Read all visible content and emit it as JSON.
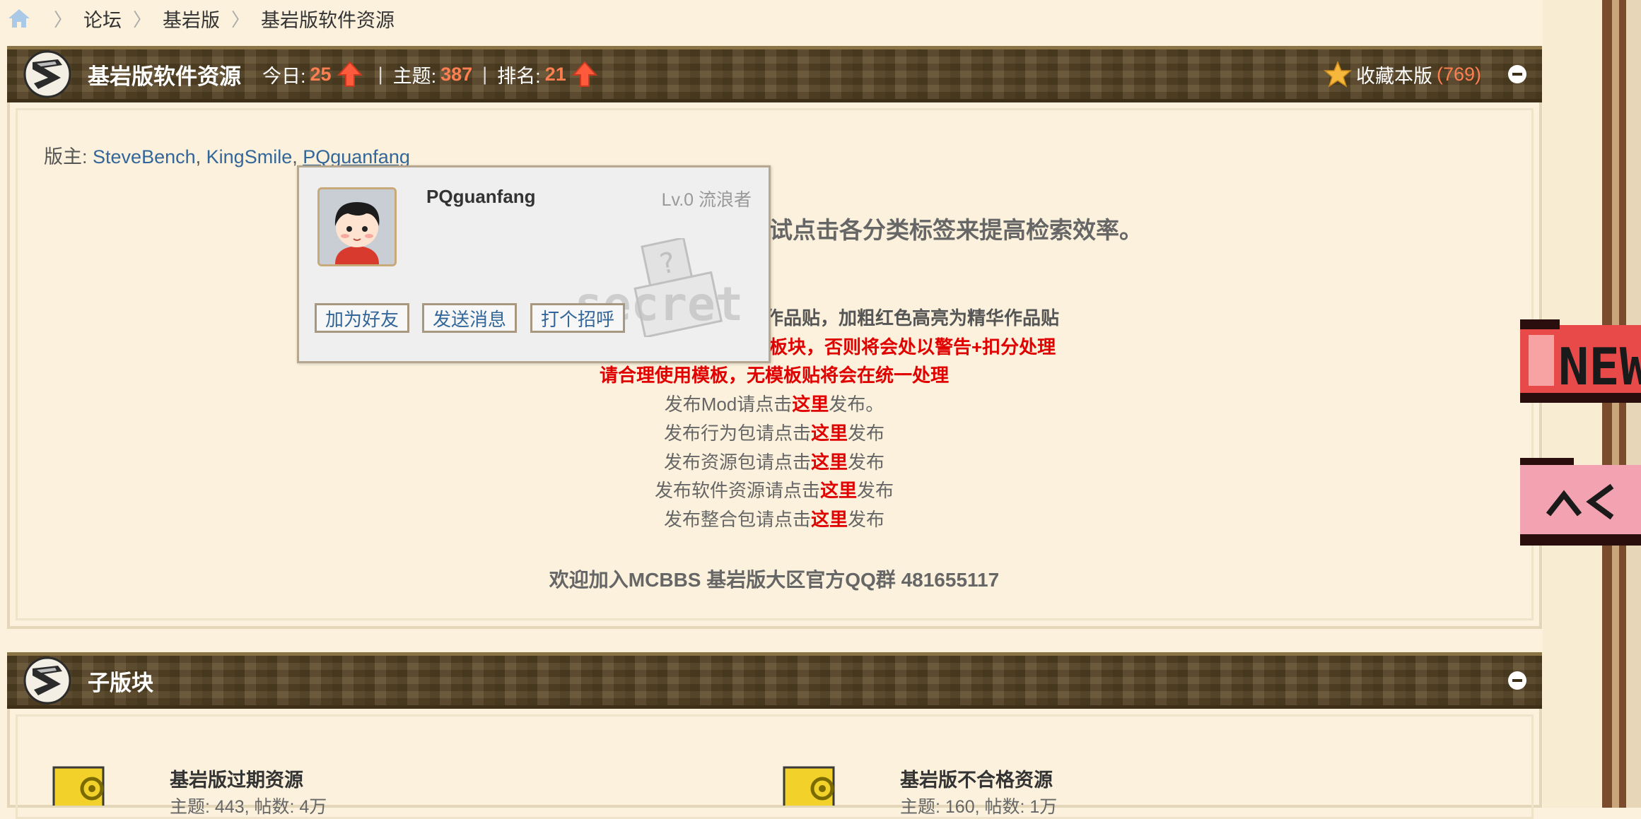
{
  "breadcrumb": {
    "items": [
      "论坛",
      "基岩版",
      "基岩版软件资源"
    ],
    "separator": "〉"
  },
  "forum_header": {
    "title": "基岩版软件资源",
    "today_label": "今日:",
    "today_value": "25",
    "topics_label": "主题:",
    "topics_value": "387",
    "rank_label": "排名:",
    "rank_value": "21",
    "favorite_label": "收藏本版",
    "favorite_count": "(769)"
  },
  "moderators": {
    "label": "版主:",
    "names": [
      "SteveBench",
      "KingSmile",
      "PQguanfang"
    ]
  },
  "popup": {
    "username": "PQguanfang",
    "level": "Lv.0 流浪者",
    "buttons": [
      "加为好友",
      "发送消息",
      "打个招呼"
    ]
  },
  "rules": {
    "line1_visible": "试点击各分类标签来提高检索效率。",
    "line2_visible": "作品贴，加粗红色高亮为精华作品贴",
    "line3_visible": "板块，否则将会处以警告+扣分处理",
    "line4": "请合理使用模板，无模板贴将会在统一处理",
    "post_mod": {
      "prefix": "发布Mod请点击",
      "link": "这里",
      "suffix": "发布。"
    },
    "post_behavior": {
      "prefix": "发布行为包请点击",
      "link": "这里",
      "suffix": "发布"
    },
    "post_resource": {
      "prefix": "发布资源包请点击",
      "link": "这里",
      "suffix": "发布"
    },
    "post_software": {
      "prefix": "发布软件资源请点击",
      "link": "这里",
      "suffix": "发布"
    },
    "post_pack": {
      "prefix": "发布整合包请点击",
      "link": "这里",
      "suffix": "发布"
    },
    "qq_group": "欢迎加入MCBBS 基岩版大区官方QQ群 481655117"
  },
  "subforum_header": {
    "title": "子版块"
  },
  "subforums": [
    {
      "name": "基岩版过期资源",
      "meta": "主题: 443, 帖数: 4万"
    },
    {
      "name": "基岩版不合格资源",
      "meta": "主题: 160, 帖数: 1万"
    }
  ],
  "colors": {
    "bar_brown": "#5e4a2a",
    "accent_orange": "#ff7f50",
    "link_blue": "#336699",
    "highlight_red": "#e00000",
    "page_bg": "#fbf1dc"
  },
  "icons": [
    "home-icon",
    "forum-logo-icon",
    "up-arrow-icon",
    "star-icon",
    "collapse-icon",
    "avatar",
    "secret-watermark-icon",
    "subforum-folder-icon",
    "new-badge-icon",
    "back-to-top-icon"
  ]
}
